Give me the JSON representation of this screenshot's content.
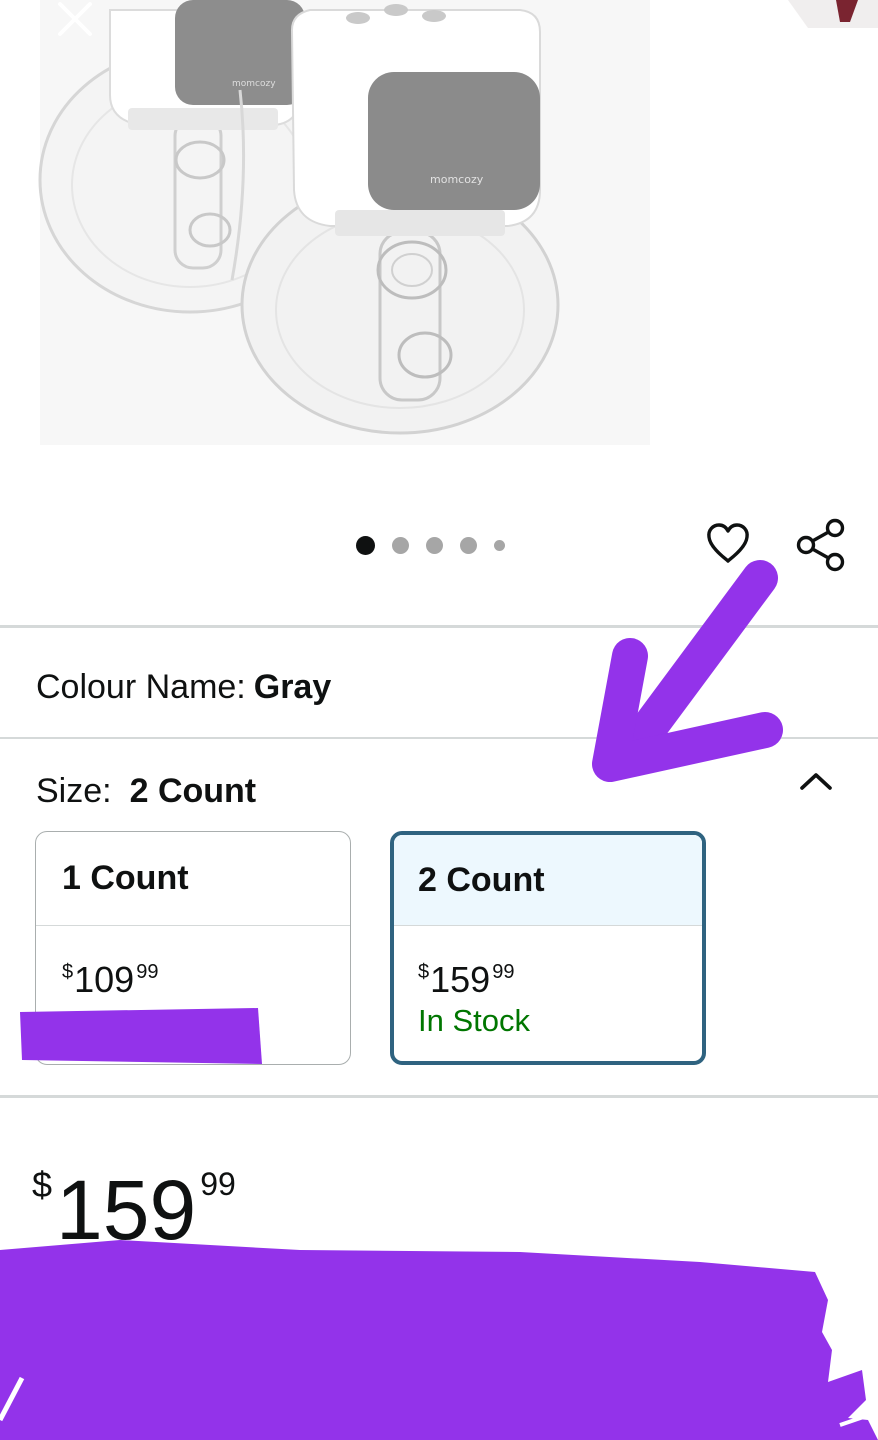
{
  "product": {
    "brand_mark": "momcozy",
    "image_count": 5,
    "active_image": 1
  },
  "icons": {
    "close": "close-icon",
    "wishlist": "heart-icon",
    "share": "share-icon",
    "collapse": "chevron-up-icon"
  },
  "colour": {
    "label": "Colour Name:",
    "value": "Gray"
  },
  "size": {
    "label": "Size:",
    "value": "2 Count",
    "options": [
      {
        "name": "1 Count",
        "price_symbol": "$",
        "price_whole": "109",
        "price_fraction": "99",
        "stock": "",
        "selected": false
      },
      {
        "name": "2 Count",
        "price_symbol": "$",
        "price_whole": "159",
        "price_fraction": "99",
        "stock": "In Stock",
        "selected": true
      }
    ]
  },
  "price": {
    "symbol": "$",
    "whole": "159",
    "fraction": "99"
  },
  "colors": {
    "annotation": "#9333ea",
    "in_stock": "#007600",
    "selected_border": "#2f6380",
    "selected_fill": "#edf8fe"
  }
}
